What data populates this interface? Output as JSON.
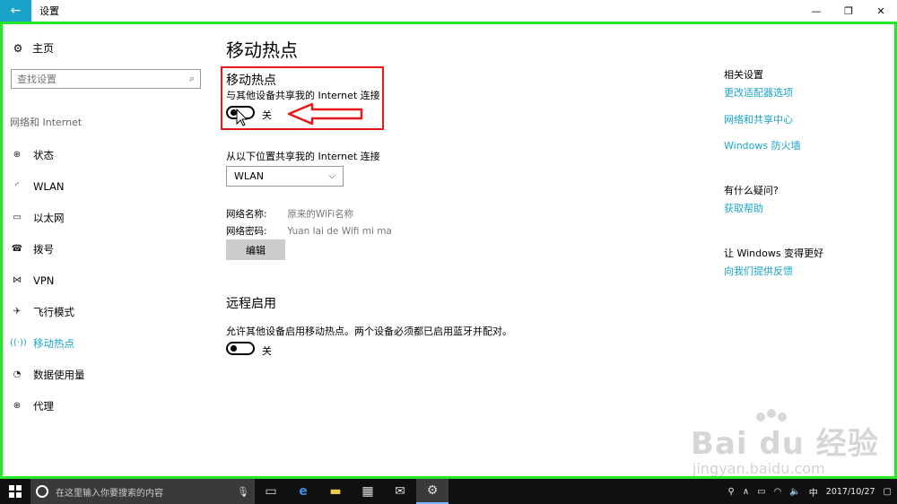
{
  "window": {
    "title": "设置",
    "back_icon": "back-arrow-icon",
    "minimize": "—",
    "restore": "❐",
    "close": "✕"
  },
  "sidebar": {
    "home_label": "主页",
    "search_placeholder": "查找设置",
    "section_label": "网络和 Internet",
    "items": [
      {
        "label": "状态",
        "icon": "status-icon"
      },
      {
        "label": "WLAN",
        "icon": "wifi-icon"
      },
      {
        "label": "以太网",
        "icon": "ethernet-icon"
      },
      {
        "label": "拨号",
        "icon": "dialup-icon"
      },
      {
        "label": "VPN",
        "icon": "vpn-icon"
      },
      {
        "label": "飞行模式",
        "icon": "airplane-icon"
      },
      {
        "label": "移动热点",
        "icon": "hotspot-icon",
        "active": true
      },
      {
        "label": "数据使用量",
        "icon": "data-usage-icon"
      },
      {
        "label": "代理",
        "icon": "proxy-icon"
      }
    ]
  },
  "main": {
    "page_title": "移动热点",
    "hotspot": {
      "title": "移动热点",
      "subtitle": "与其他设备共享我的 Internet 连接",
      "toggle_state": "关"
    },
    "share_from": {
      "label": "从以下位置共享我的 Internet 连接",
      "selected": "WLAN"
    },
    "network_name": {
      "key": "网络名称:",
      "value": "原来的WiFi名称"
    },
    "network_password": {
      "key": "网络密码:",
      "value": "Yuan lai de Wifi mi ma"
    },
    "edit_label": "编辑",
    "remote": {
      "title": "远程启用",
      "description": "允许其他设备启用移动热点。两个设备必须都已启用蓝牙并配对。",
      "toggle_state": "关"
    }
  },
  "right": {
    "related_heading": "相关设置",
    "related_links": [
      "更改适配器选项",
      "网络和共享中心",
      "Windows 防火墙"
    ],
    "question_heading": "有什么疑问?",
    "help_link": "获取帮助",
    "improve_heading": "让 Windows 变得更好",
    "feedback_link": "向我们提供反馈"
  },
  "watermark": {
    "brand": "Bai du 经验",
    "url": "jingyan.baidu.com"
  },
  "taskbar": {
    "search_placeholder": "在这里输入你要搜索的内容",
    "input_method": "中",
    "date": "2017/10/27"
  },
  "colors": {
    "accent": "#1aa3c9",
    "highlight_box": "#e81818",
    "frame": "#27e627",
    "taskbar": "#101010"
  }
}
